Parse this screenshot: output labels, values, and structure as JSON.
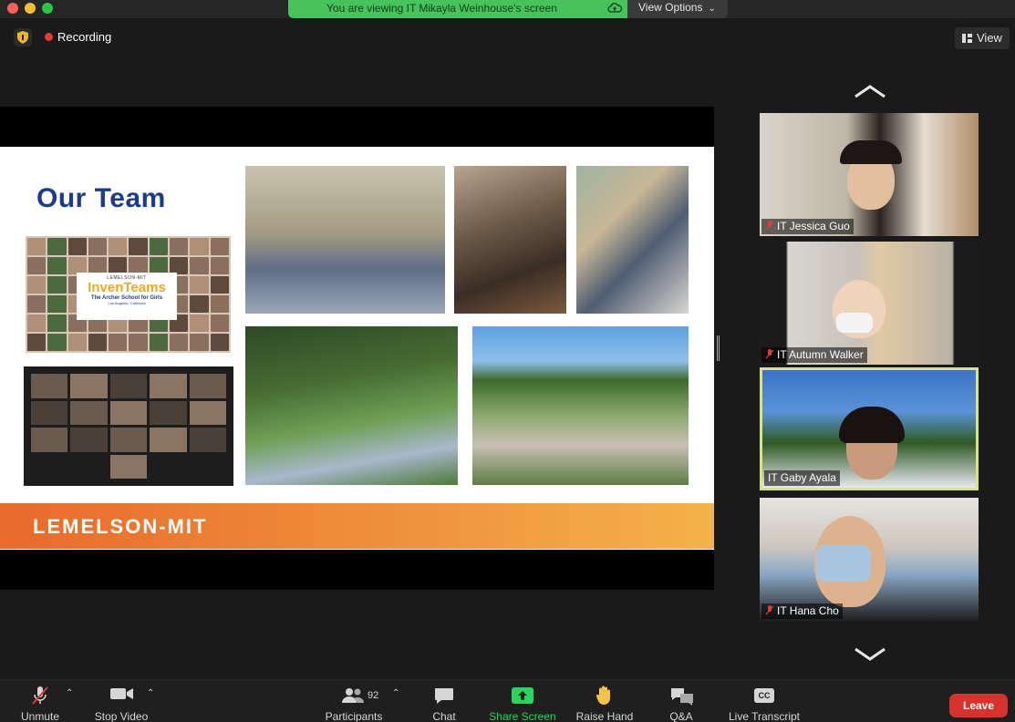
{
  "window": {
    "banner_text": "You are viewing IT Mikayla Weinhouse's screen",
    "view_options_label": "View Options",
    "view_button_label": "View"
  },
  "recording": {
    "label": "Recording"
  },
  "slide": {
    "title": "Our Team",
    "logo_small": "LEMELSON-MIT",
    "logo_main": "InvenTeams",
    "school": "The Archer School for Girls",
    "city": "Los Angeles, California",
    "footer_brand": "LEMELSON-MIT"
  },
  "gallery": {
    "participants": [
      {
        "name": "IT Jessica Guo",
        "muted": true
      },
      {
        "name": "IT Autumn Walker",
        "muted": true
      },
      {
        "name": "IT Gaby Ayala",
        "muted": false,
        "active": true
      },
      {
        "name": "IT Hana Cho",
        "muted": true
      }
    ]
  },
  "toolbar": {
    "unmute_label": "Unmute",
    "stop_video_label": "Stop Video",
    "participants_label": "Participants",
    "participants_count": "92",
    "chat_label": "Chat",
    "share_screen_label": "Share Screen",
    "raise_hand_label": "Raise Hand",
    "qa_label": "Q&A",
    "live_transcript_label": "Live Transcript",
    "cc_badge": "CC",
    "leave_label": "Leave"
  },
  "colors": {
    "banner_green": "#48c35b",
    "active_speaker_border": "#d7e57a",
    "leave_red": "#d7322b",
    "share_green": "#23d959",
    "slide_title_blue": "#1b3b8f"
  }
}
